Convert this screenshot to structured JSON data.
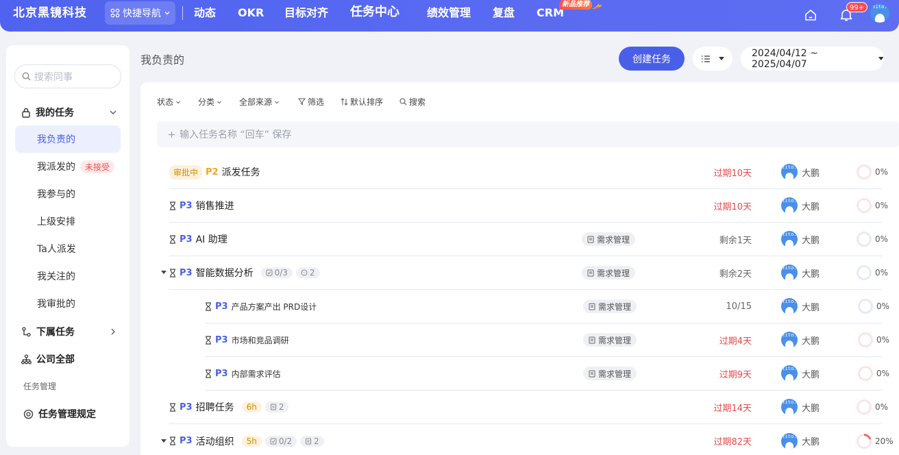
{
  "topbar": {
    "brand": "北京黑镜科技",
    "quick_nav": "快捷导航",
    "nav": [
      "动态",
      "OKR",
      "目标对齐",
      "任务中心",
      "绩效管理",
      "复盘",
      "CRM"
    ],
    "new_tag": "新品推荐",
    "notification_count": "99+",
    "avatar_text": "tito."
  },
  "sidebar": {
    "search_placeholder": "搜索同事",
    "my_tasks": "我的任务",
    "items": [
      {
        "label": "我负责的"
      },
      {
        "label": "我派发的",
        "tag": "未接受"
      },
      {
        "label": "我参与的"
      },
      {
        "label": "上级安排"
      },
      {
        "label": "Ta人派发"
      },
      {
        "label": "我关注的"
      },
      {
        "label": "我审批的"
      }
    ],
    "sub_tasks": "下属任务",
    "company_all": "公司全部",
    "section_label": "任务管理",
    "rules": "任务管理规定"
  },
  "header": {
    "title": "我负责的",
    "create_button": "创建任务",
    "date_range": "2024/04/12 ~ 2025/04/07"
  },
  "filters": {
    "status": "状态",
    "category": "分类",
    "source": "全部来源",
    "filter": "筛选",
    "sort": "默认排序",
    "search": "搜索"
  },
  "quick_add_placeholder": "输入任务名称 “回车” 保存",
  "tasks": [
    {
      "status": "审批中",
      "priority": "P2",
      "name": "派发任务",
      "category": "",
      "due": "过期10天",
      "owner": "大鹏",
      "progress": "0%"
    },
    {
      "priority": "P3",
      "name": "销售推进",
      "category": "",
      "due": "过期10天",
      "owner": "大鹏",
      "progress": "0%"
    },
    {
      "priority": "P3",
      "name": "AI 助理",
      "category": "需求管理",
      "due": "剩余1天",
      "owner": "大鹏",
      "progress": "0%"
    },
    {
      "priority": "P3",
      "name": "智能数据分析",
      "checklist": "0/3",
      "comments": "2",
      "category": "需求管理",
      "due": "剩余2天",
      "owner": "大鹏",
      "progress": "0%"
    },
    {
      "priority": "P3",
      "name": "产品方案产出 PRD设计",
      "category": "需求管理",
      "due": "10/15",
      "owner": "大鹏",
      "progress": "0%"
    },
    {
      "priority": "P3",
      "name": "市场和竞品调研",
      "category": "需求管理",
      "due": "过期4天",
      "owner": "大鹏",
      "progress": "0%"
    },
    {
      "priority": "P3",
      "name": "内部需求评估",
      "category": "需求管理",
      "due": "过期9天",
      "owner": "大鹏",
      "progress": "0%"
    },
    {
      "priority": "P3",
      "name": "招聘任务",
      "hours": "6h",
      "subtasks": "2",
      "category": "",
      "due": "过期14天",
      "owner": "大鹏",
      "progress": "0%"
    },
    {
      "priority": "P3",
      "name": "活动组织",
      "hours": "5h",
      "checklist": "0/2",
      "subtasks": "2",
      "category": "",
      "due": "过期82天",
      "owner": "大鹏",
      "progress": "20%"
    }
  ],
  "colors": {
    "accent": "#4a5fe8",
    "overdue": "#e64848",
    "pending": "#d38a00"
  }
}
